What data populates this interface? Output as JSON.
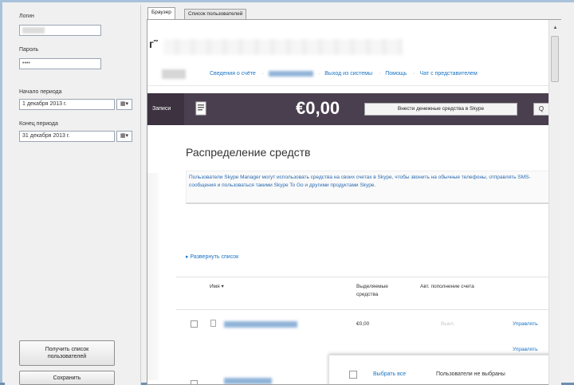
{
  "left_panel": {
    "login_label": "Логин",
    "password_label": "Пароль",
    "password_value": "••••",
    "period_start_label": "Начало периода",
    "period_start_value": "1   декабря   2013 г.",
    "period_end_label": "Конец периода",
    "period_end_value": "31   декабря   2013 г.",
    "date_button_glyph": "▦▾",
    "get_users_button": "Получить список пользователей",
    "save_button": "Сохранить"
  },
  "tabs": [
    {
      "label": "Браузер"
    },
    {
      "label": "Список пользователей"
    }
  ],
  "browser": {
    "brand_fragment": "г˜",
    "top_links": [
      "Сведения о счёте",
      "Выход из системы",
      "Помощь",
      "Чат с представителем"
    ],
    "tab_label": "Записи",
    "credit_amount": "€0,00",
    "transfer_button": "Внести денежные средства в Skype",
    "search_glyph": "Q",
    "section_title": "Распределение средств",
    "description": "Пользователи Skype Manager могут использовать средства на своих счетах в Skype, чтобы звонить на обычные телефоны, отправлять SMS-сообщения и пользоваться такими Skype To Go и другими продуктами Skype.",
    "expand_link": "▸ Развернуть список",
    "table": {
      "headers": {
        "name": "Имя ▾",
        "allocated": "Выделяемые средства",
        "auto_topup": "Авт. пополнение счета"
      },
      "row": {
        "amount": "€0,00",
        "auto_status": "Выкл.",
        "manage": "Управлять"
      },
      "manage2": "Управлять"
    },
    "popup": {
      "select_all": "Выбрать все",
      "selected_users": "Пользователи не выбраны"
    }
  },
  "colors": {
    "dark_bar": "#4a3f4f",
    "link": "#1a74c4"
  }
}
